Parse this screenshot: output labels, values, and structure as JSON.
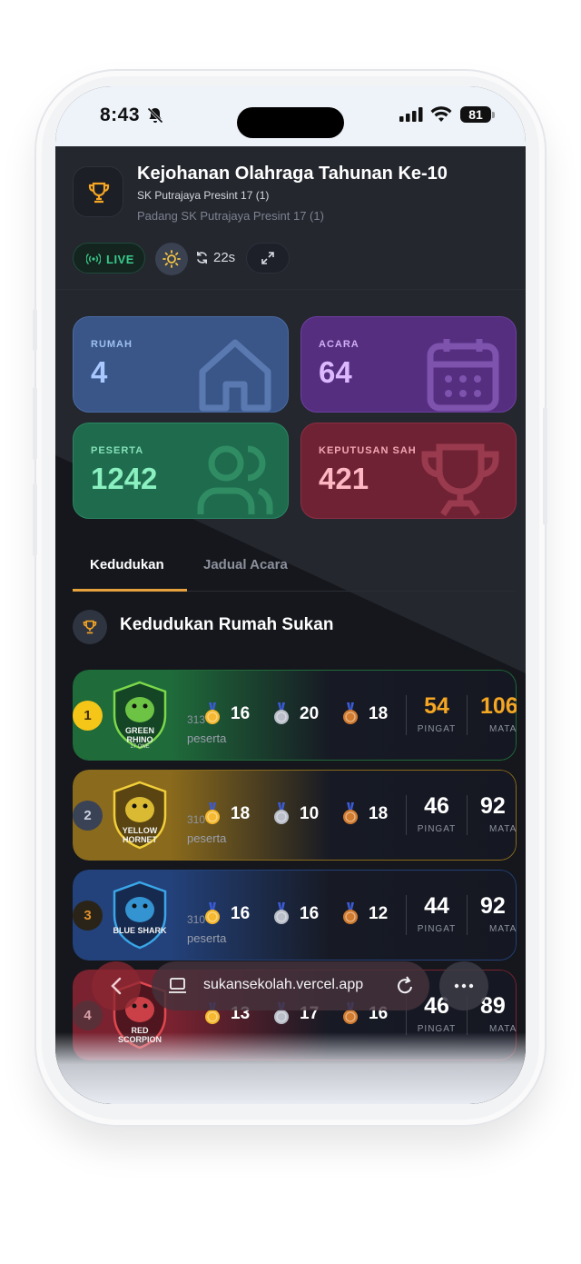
{
  "status_bar": {
    "time": "8:43",
    "battery": "81"
  },
  "header": {
    "title": "Kejohanan Olahraga Tahunan Ke-10",
    "school": "SK Putrajaya Presint 17 (1)",
    "venue": "Padang SK Putrajaya Presint 17 (1)",
    "live_label": "LIVE",
    "refresh_countdown": "22s"
  },
  "stats": [
    {
      "label": "RUMAH",
      "value": "4",
      "icon": "house-icon"
    },
    {
      "label": "ACARA",
      "value": "64",
      "icon": "calendar-icon"
    },
    {
      "label": "PESERTA",
      "value": "1242",
      "icon": "users-icon"
    },
    {
      "label": "KEPUTUSAN SAH",
      "value": "421",
      "icon": "trophy-icon"
    }
  ],
  "tabs": [
    {
      "label": "Kedudukan",
      "active": true
    },
    {
      "label": "Jadual Acara",
      "active": false
    }
  ],
  "section_title": "Kedudukan Rumah Sukan",
  "standings": [
    {
      "rank": "1",
      "team": "GREEN RHINO",
      "team_sub": "17 ONE",
      "count": "313",
      "peserta_label": "peserta",
      "gold": "16",
      "silver": "20",
      "bronze": "18",
      "pingat": "54",
      "pingat_label": "PINGAT",
      "mata": "106",
      "mata_label": "MATA",
      "color": "#1f6b3a"
    },
    {
      "rank": "2",
      "team": "YELLOW HORNET",
      "team_sub": "",
      "count": "310",
      "peserta_label": "peserta",
      "gold": "18",
      "silver": "10",
      "bronze": "18",
      "pingat": "46",
      "pingat_label": "PINGAT",
      "mata": "92",
      "mata_label": "MATA",
      "color": "#8a6a1c"
    },
    {
      "rank": "3",
      "team": "BLUE SHARK",
      "team_sub": "",
      "count": "310",
      "peserta_label": "peserta",
      "gold": "16",
      "silver": "16",
      "bronze": "12",
      "pingat": "44",
      "pingat_label": "PINGAT",
      "mata": "92",
      "mata_label": "MATA",
      "color": "#23417a"
    },
    {
      "rank": "4",
      "team": "RED SCORPION",
      "team_sub": "",
      "count": "",
      "peserta_label": "",
      "gold": "13",
      "silver": "17",
      "bronze": "16",
      "pingat": "46",
      "pingat_label": "PINGAT",
      "mata": "89",
      "mata_label": "MATA",
      "color": "#7a2230"
    }
  ],
  "browser": {
    "url": "sukansekolah.vercel.app"
  },
  "colors": {
    "accent": "#e6a23c",
    "live": "#38c98b",
    "gold": "#f5a623",
    "background": "#15171c"
  }
}
